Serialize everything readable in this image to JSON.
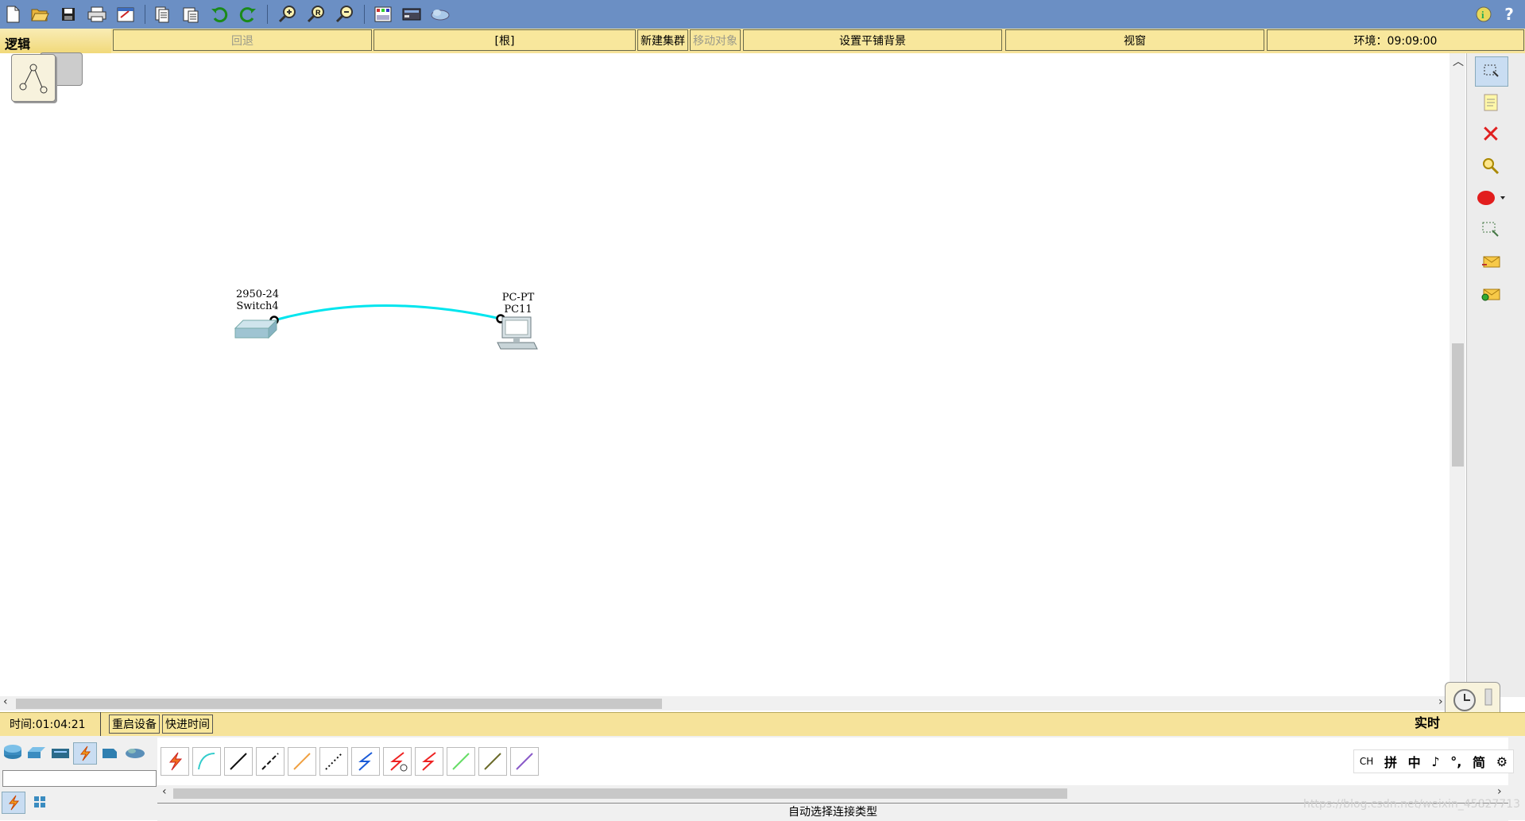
{
  "toolbar": {
    "icons": [
      "new-file",
      "open-folder",
      "save",
      "print",
      "activity-wizard",
      "copy",
      "paste",
      "undo",
      "redo",
      "zoom-in",
      "zoom-reset",
      "zoom-out",
      "drawing-palette",
      "custom-device",
      "cluster-cloud"
    ],
    "right_icons": [
      "info",
      "help"
    ],
    "help_label": "?"
  },
  "logicbar": {
    "tab_label": "逻辑",
    "back_label": "回退",
    "root_label": "[根]",
    "new_cluster_label": "新建集群",
    "move_object_label": "移动对象",
    "set_background_label": "设置平铺背景",
    "viewport_label": "视窗",
    "environment_label": "环境：09:09:00"
  },
  "canvas": {
    "devices": [
      {
        "model": "2950-24",
        "name": "Switch4",
        "type": "switch"
      },
      {
        "model": "PC-PT",
        "name": "PC11",
        "type": "pc"
      }
    ],
    "link": {
      "color": "#00e5ee",
      "from": "Switch4",
      "to": "PC11"
    }
  },
  "rightpanel": {
    "tools": [
      "select",
      "note",
      "delete",
      "inspect",
      "draw-shape",
      "resize",
      "add-simple-pdu",
      "add-complex-pdu"
    ]
  },
  "status": {
    "time_label": "时间:01:04:21",
    "power_cycle_label": "重启设备",
    "fast_forward_label": "快进时间",
    "realtime_label": "实时"
  },
  "bottom": {
    "device_categories": [
      "routers",
      "switches",
      "hubs",
      "connections",
      "end-devices",
      "wan-emulation"
    ],
    "cable_types": [
      "auto",
      "console",
      "copper-straight",
      "copper-cross",
      "fiber",
      "phone",
      "coaxial",
      "serial-dce",
      "serial-dte",
      "octal",
      "iot-custom",
      "usb"
    ],
    "status_text": "自动选择连接类型",
    "ime": [
      "CH",
      "拼",
      "中",
      "♪",
      "°,",
      "简",
      "⚙"
    ],
    "watermark": "https://blog.csdn.net/weixin_45827713"
  }
}
